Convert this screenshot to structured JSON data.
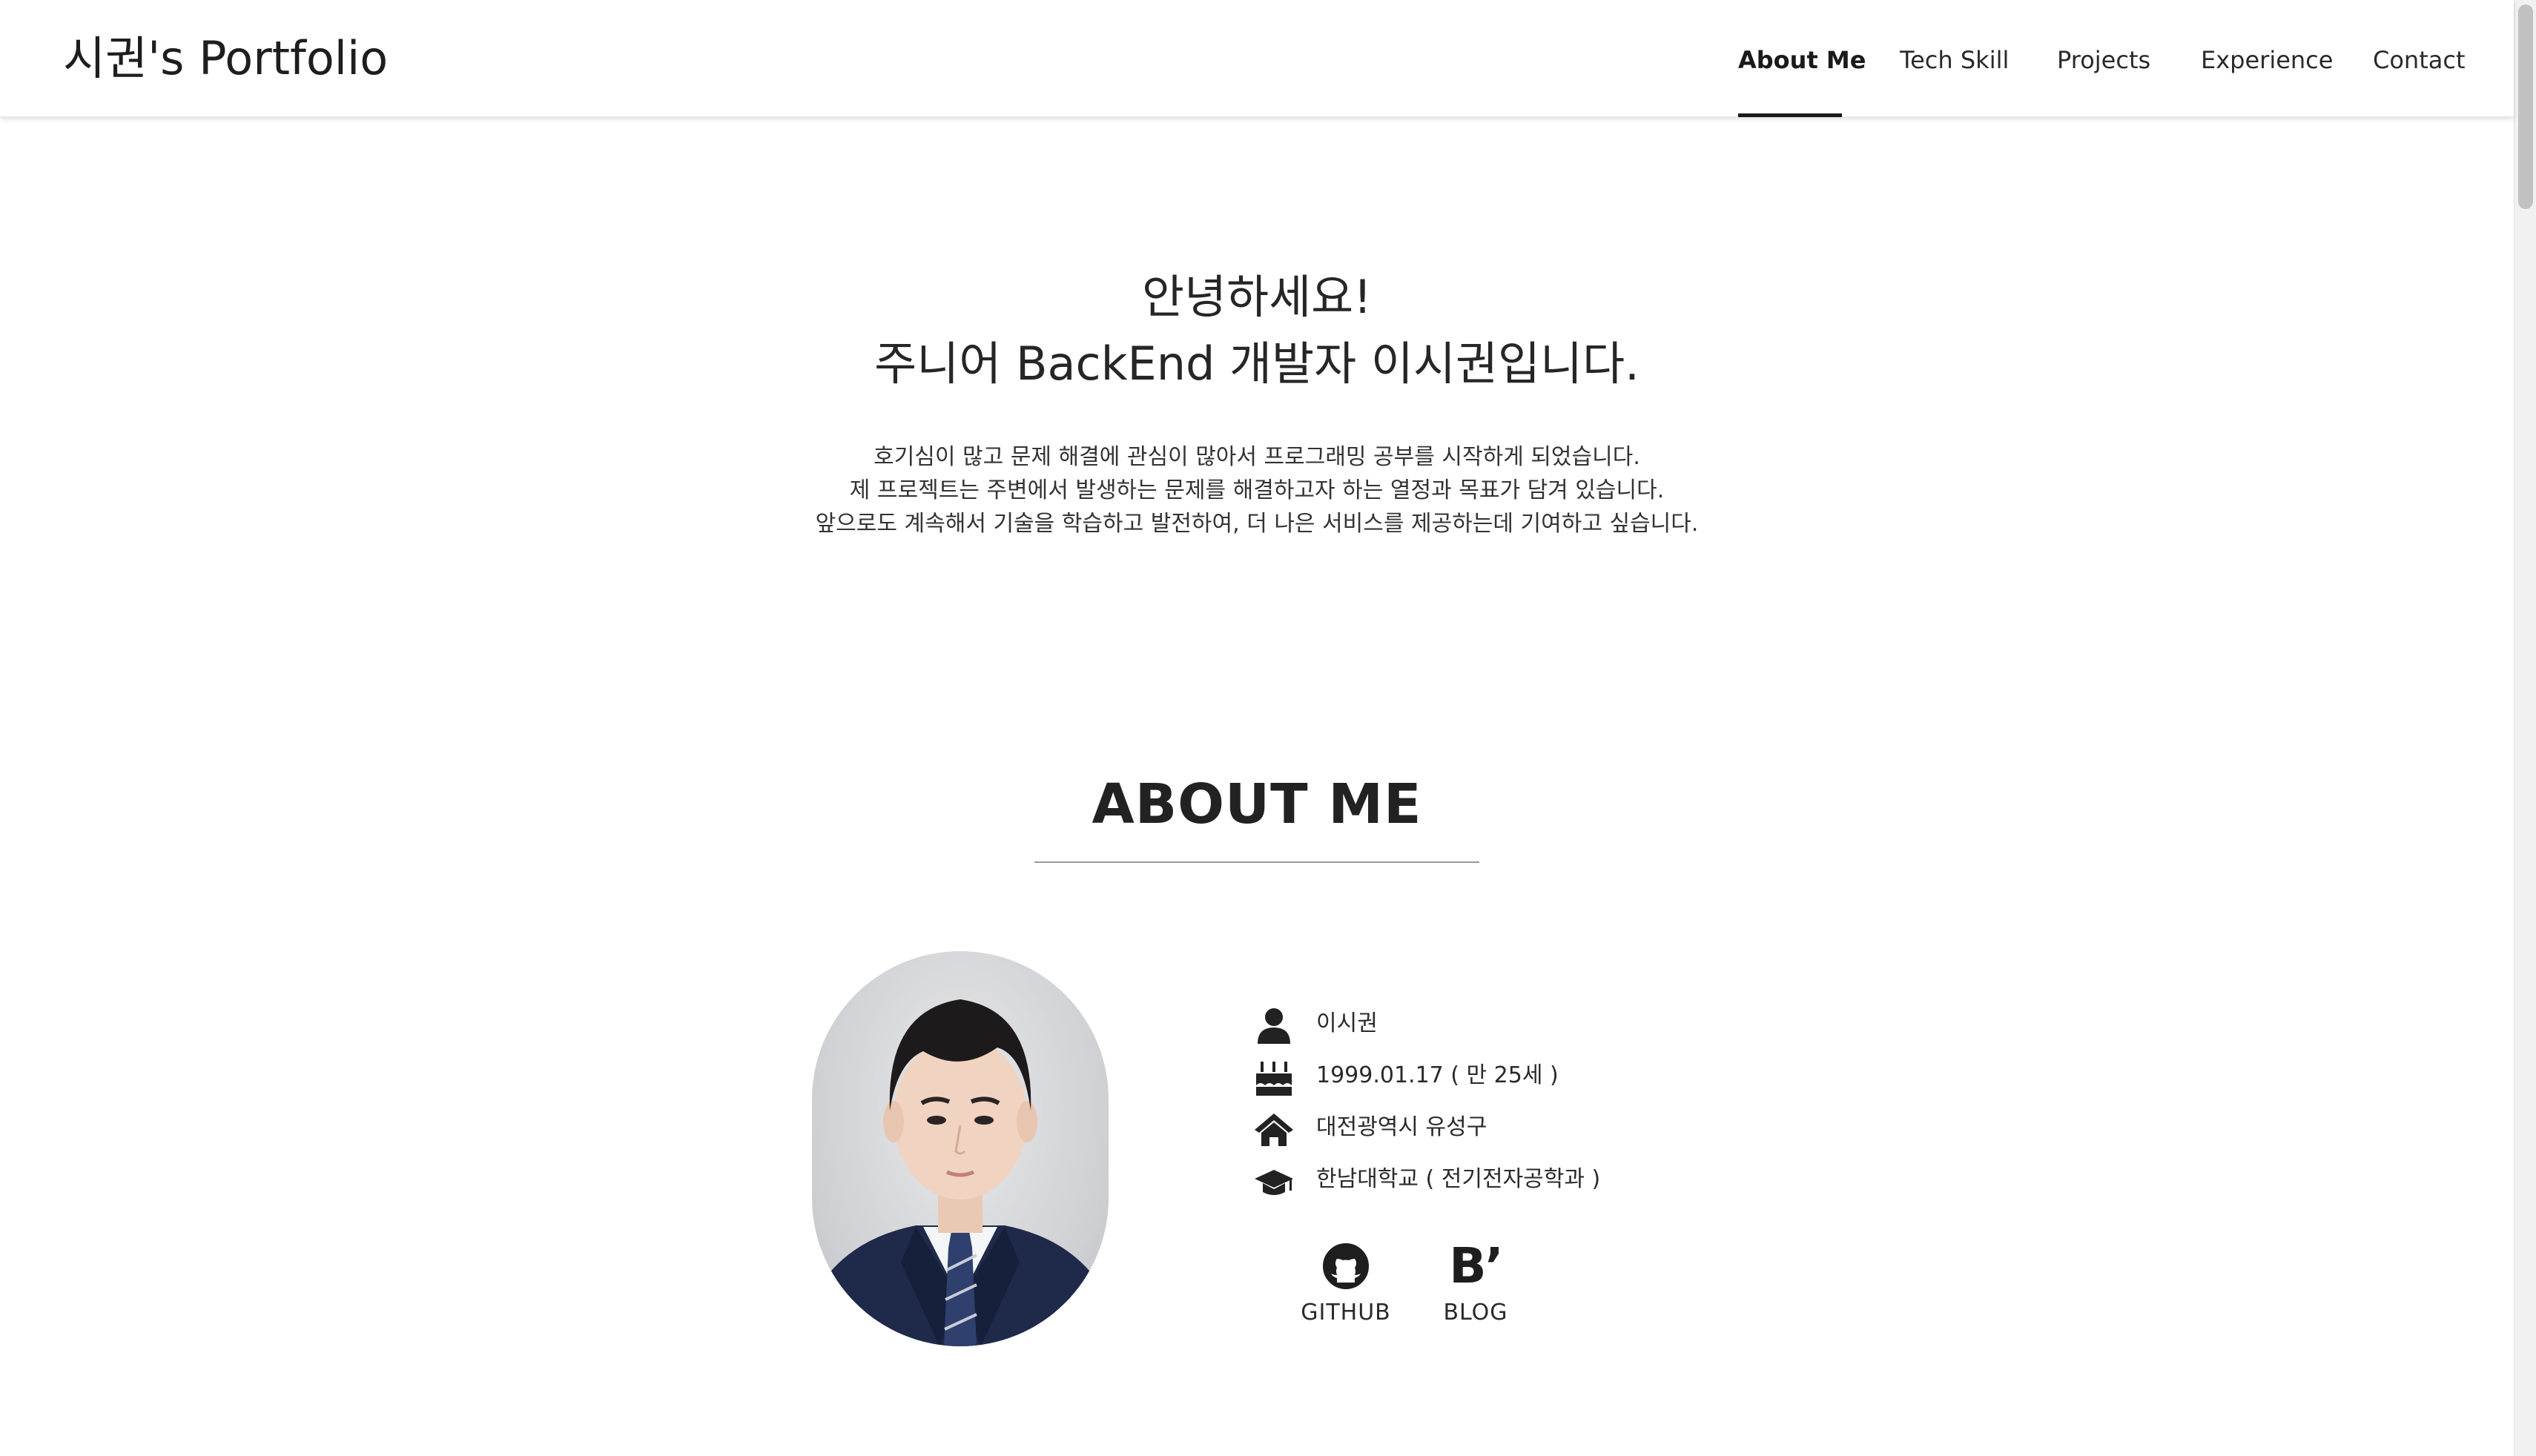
{
  "nav": {
    "brand": "시권's Portfolio",
    "items": [
      {
        "label": "About Me",
        "active": true
      },
      {
        "label": "Tech Skill",
        "active": false
      },
      {
        "label": "Projects",
        "active": false
      },
      {
        "label": "Experience",
        "active": false
      },
      {
        "label": "Contact",
        "active": false
      }
    ]
  },
  "hero": {
    "greeting": "안녕하세요!",
    "intro": "주니어 BackEnd 개발자 이시권입니다.",
    "paragraph": [
      "호기심이 많고 문제 해결에 관심이 많아서 프로그래밍 공부를 시작하게 되었습니다.",
      "제 프로젝트는 주변에서 발생하는 문제를 해결하고자 하는 열정과 목표가 담겨 있습니다.",
      "앞으로도 계속해서 기술을 학습하고 발전하여, 더 나은 서비스를 제공하는데 기여하고 싶습니다."
    ]
  },
  "about": {
    "title": "ABOUT ME",
    "info": [
      {
        "icon": "user-icon",
        "text": "이시권"
      },
      {
        "icon": "birthday-cake-icon",
        "text": "1999.01.17 ( 만 25세 )"
      },
      {
        "icon": "home-icon",
        "text": "대전광역시 유성구"
      },
      {
        "icon": "graduation-cap-icon",
        "text": "한남대학교 ( 전기전자공학과 )"
      }
    ],
    "social": [
      {
        "icon": "github-icon",
        "label": "GITHUB"
      },
      {
        "icon": "blog-icon",
        "label": "BLOG",
        "glyph": "B’"
      }
    ]
  },
  "colors": {
    "text": "#222222",
    "background": "#ffffff",
    "divider": "#9a9a9a",
    "suit": "#1f2a4a"
  }
}
